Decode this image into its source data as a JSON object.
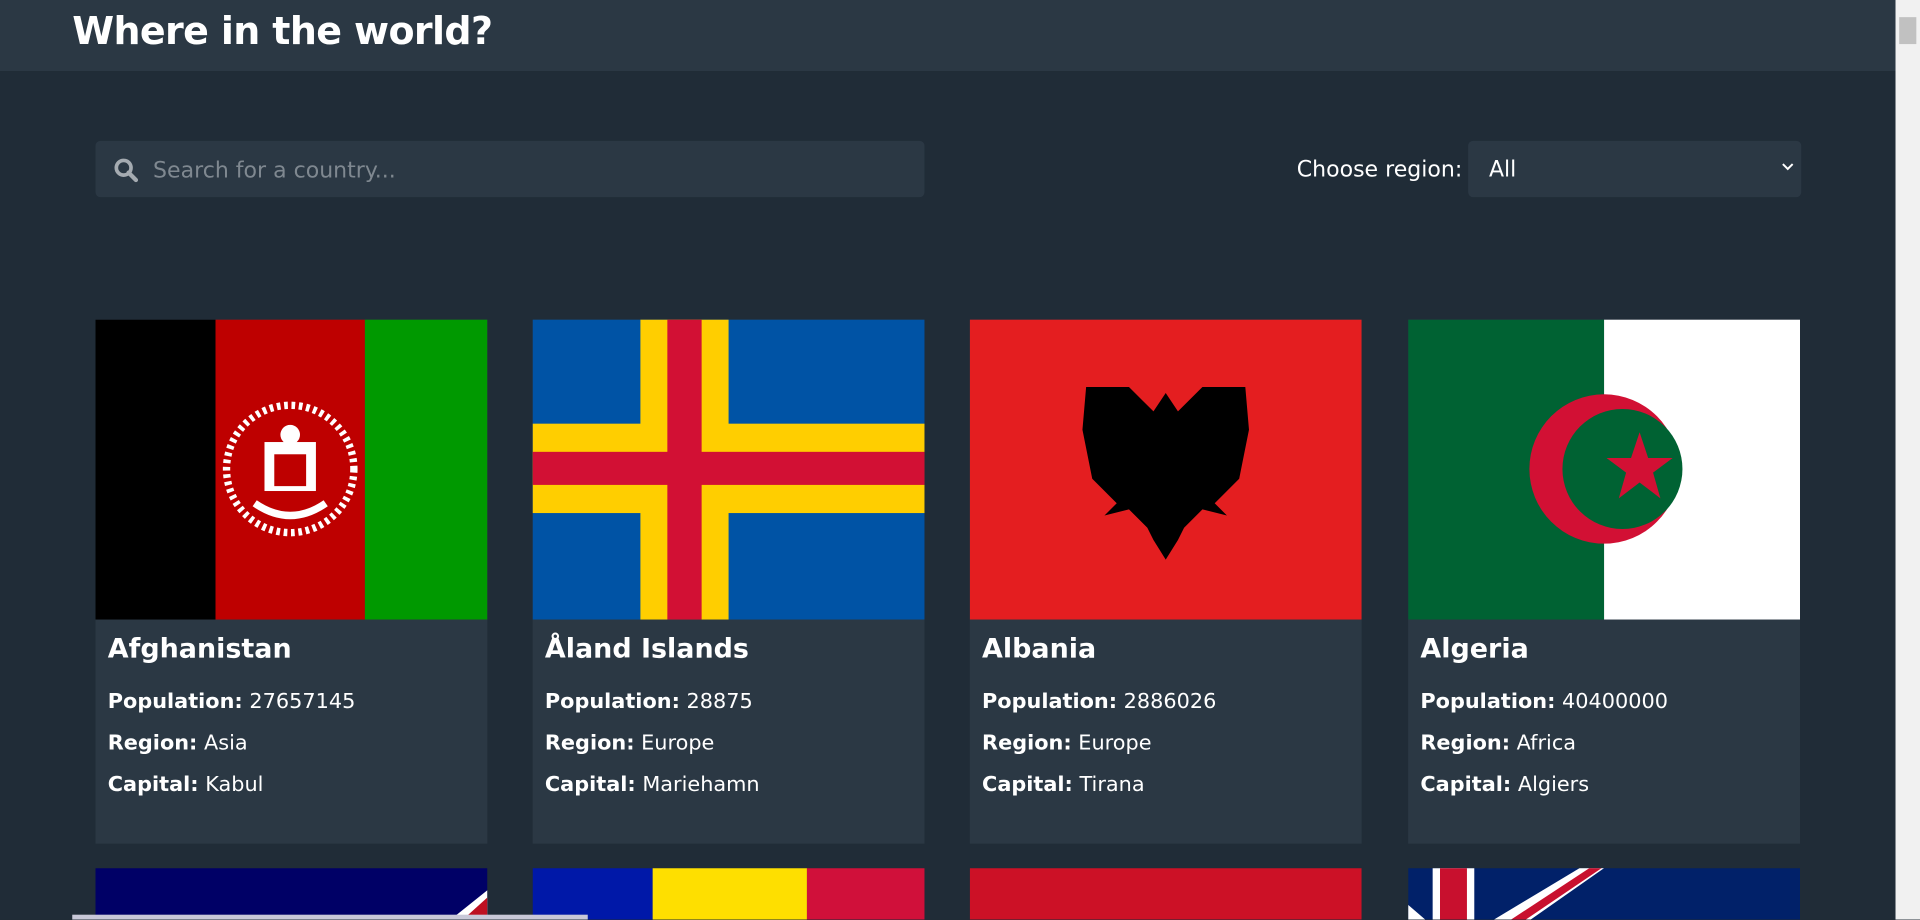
{
  "header": {
    "title": "Where in the world?"
  },
  "search": {
    "placeholder": "Search for a country...",
    "value": ""
  },
  "filter": {
    "label": "Choose region:",
    "selected": "All"
  },
  "labels": {
    "population": "Population:",
    "region": "Region:",
    "capital": "Capital:"
  },
  "countries": [
    {
      "name": "Afghanistan",
      "population": "27657145",
      "region": "Asia",
      "capital": "Kabul"
    },
    {
      "name": "Åland Islands",
      "population": "28875",
      "region": "Europe",
      "capital": "Mariehamn"
    },
    {
      "name": "Albania",
      "population": "2886026",
      "region": "Europe",
      "capital": "Tirana"
    },
    {
      "name": "Algeria",
      "population": "40400000",
      "region": "Africa",
      "capital": "Algiers"
    }
  ],
  "colors": {
    "background": "#202c37",
    "surface": "#2b3844",
    "text": "#ffffff"
  }
}
